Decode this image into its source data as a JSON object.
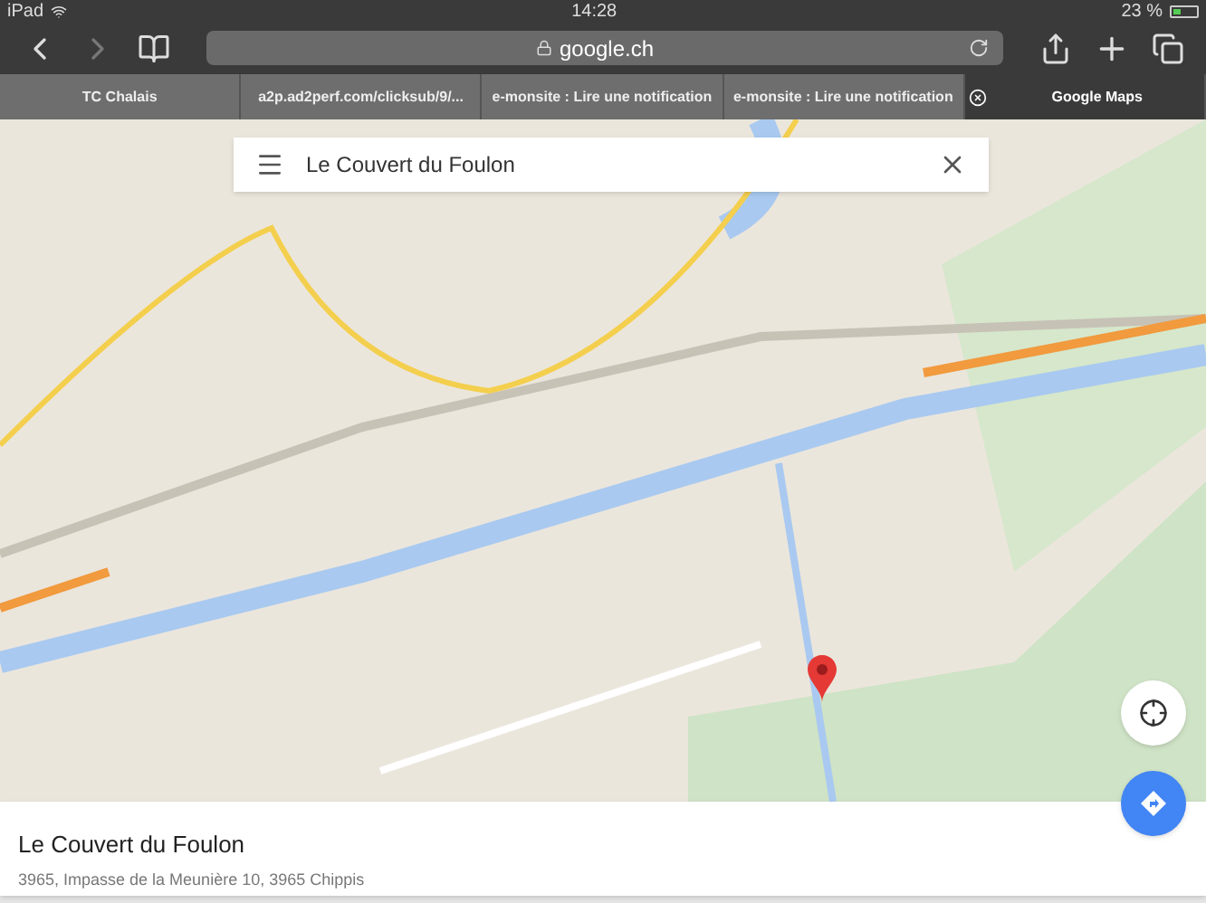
{
  "status_bar": {
    "device": "iPad",
    "time": "14:28",
    "battery": "23 %"
  },
  "toolbar": {
    "url": "google.ch"
  },
  "tabs": [
    {
      "label": "TC Chalais",
      "selected": false
    },
    {
      "label": "a2p.ad2perf.com/clicksub/9/...",
      "selected": false
    },
    {
      "label": "e-monsite : Lire une notification",
      "selected": false
    },
    {
      "label": "e-monsite : Lire une notification",
      "selected": false
    },
    {
      "label": "Google Maps",
      "selected": true
    }
  ],
  "search": {
    "value": "Le Couvert du Foulon"
  },
  "place": {
    "name": "Le Couvert du Foulon",
    "address": "3965, Impasse de la Meunière 10, 3965 Chippis"
  }
}
